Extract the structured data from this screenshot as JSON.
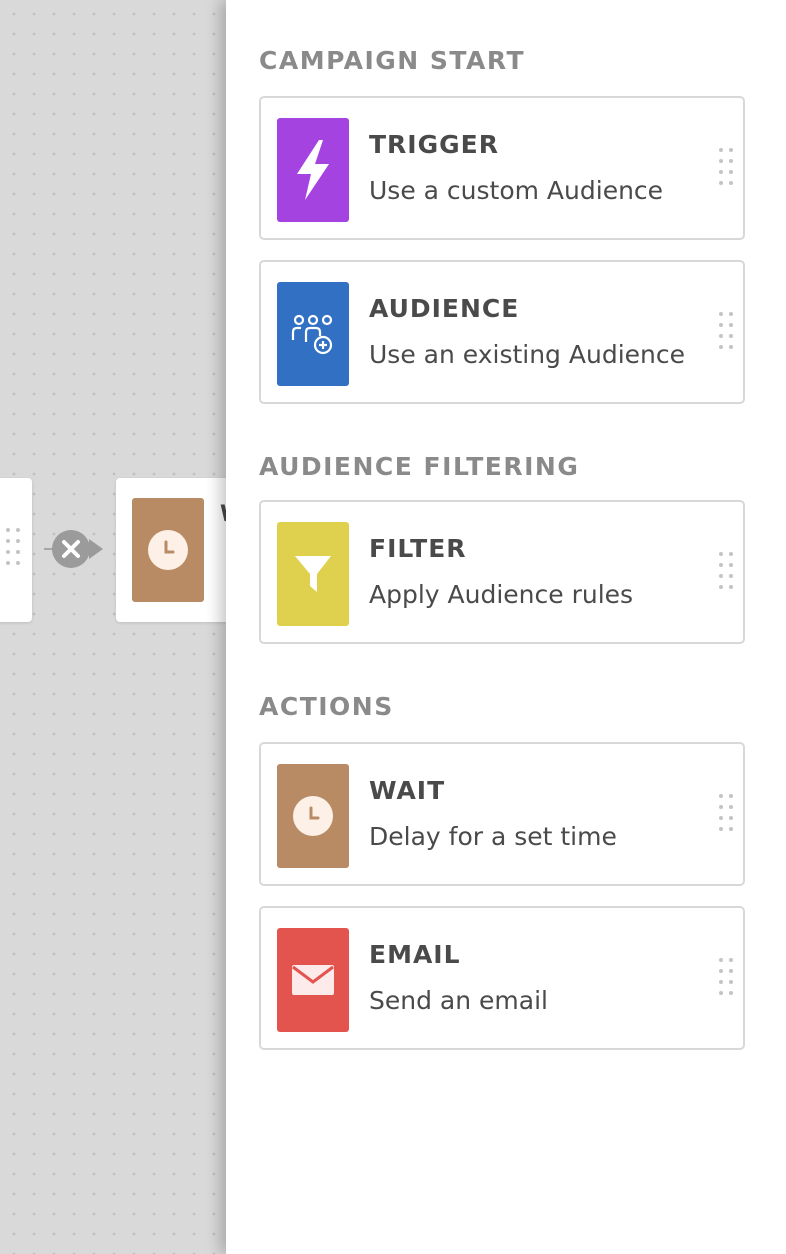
{
  "colors": {
    "trigger": "#a543e0",
    "audience": "#3270c4",
    "filter": "#dfd14e",
    "wait": "#b98b65",
    "email": "#e3544f",
    "section_header": "#8a8a8a",
    "card_text": "#4a4a4a",
    "canvas_bg": "#d9d9d9"
  },
  "canvas": {
    "nodes": [
      {
        "type": "partial",
        "icon": "drag-handle-icon"
      },
      {
        "type": "wait",
        "icon": "clock-icon",
        "title_fragment": "W"
      }
    ],
    "connection": {
      "remove_icon": "close-x-icon"
    }
  },
  "panel": {
    "sections": [
      {
        "header": "CAMPAIGN START",
        "cards": [
          {
            "title": "TRIGGER",
            "description": "Use a custom Audience",
            "icon": "lightning-icon"
          },
          {
            "title": "AUDIENCE",
            "description": "Use an existing Audience",
            "icon": "audience-add-icon"
          }
        ]
      },
      {
        "header": "AUDIENCE FILTERING",
        "cards": [
          {
            "title": "FILTER",
            "description": "Apply Audience rules",
            "icon": "funnel-icon"
          }
        ]
      },
      {
        "header": "ACTIONS",
        "cards": [
          {
            "title": "WAIT",
            "description": "Delay for a set time",
            "icon": "clock-icon"
          },
          {
            "title": "EMAIL",
            "description": "Send an email",
            "icon": "envelope-icon"
          }
        ]
      }
    ]
  }
}
